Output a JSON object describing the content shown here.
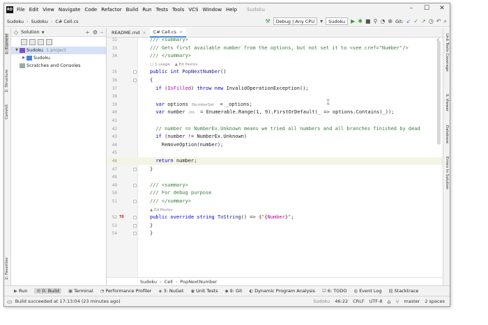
{
  "menu": [
    "File",
    "Edit",
    "View",
    "Navigate",
    "Code",
    "Refactor",
    "Build",
    "Run",
    "Tests",
    "Tools",
    "VCS",
    "Window",
    "Help"
  ],
  "project_title": "Sudoku",
  "toolbar": {
    "crumbs": [
      "Sudoku",
      "Sudoku",
      "C# Cell.cs"
    ],
    "config": "Debug | Any CPU",
    "run_target": "Sudoku",
    "git_label": "Git:"
  },
  "solution": {
    "header": "Solution",
    "tree": [
      {
        "label": "Sudoku",
        "sub": "1 project",
        "level": 0,
        "selected": true,
        "expanded": true
      },
      {
        "label": "Sudoku",
        "sub": "",
        "level": 1,
        "selected": false,
        "expanded": false
      },
      {
        "label": "Scratches and Consoles",
        "sub": "",
        "level": 0,
        "selected": false,
        "expanded": false
      }
    ]
  },
  "left_tabs": [
    "1: Explorer",
    "2: Structure",
    "Commit"
  ],
  "left_tabs_bottom": [
    "2: Favorites"
  ],
  "right_tabs": [
    "Unit Tests Coverage",
    "IL Viewer",
    "Database",
    "Errors In Solution"
  ],
  "editor": {
    "tabs": [
      {
        "label": "README.md",
        "active": false
      },
      {
        "label": "C# Cell.cs",
        "active": true
      }
    ],
    "breadcrumb": [
      "Sudoku",
      "Cell",
      "PopNextNumber"
    ],
    "lines": [
      {
        "n": "32",
        "html": "<span class='c'>/// &lt;summary&gt;</span>"
      },
      {
        "n": "33",
        "html": "<span class='c'>/// Gets first available number from the options, but not set it to &lt;see cref=\"Number\"/&gt;</span>"
      },
      {
        "n": "34",
        "html": "<span class='c'>/// &lt;/summary&gt;</span>"
      },
      {
        "n": "",
        "html": "<span class='hint'>▢ 1 usage    ▲ Ed Pavlov</span>",
        "hint": true
      },
      {
        "n": "35",
        "html": "<span class='k'>public int</span> <span class='m'>PopNextNumber</span>()"
      },
      {
        "n": "36",
        "html": "{"
      },
      {
        "n": "37",
        "html": "  <span class='k'>if</span> (<span class='t'>IsFilled</span>) <span class='k'>throw new</span> InvalidOperationException();"
      },
      {
        "n": "38",
        "html": ""
      },
      {
        "n": "39",
        "html": "  <span class='k'>var</span> options <span class='hint'>:NumberSet</span>  = _options;"
      },
      {
        "n": "40",
        "html": "  <span class='k'>var</span> number <span class='hint'>:int</span>  = Enumerable.Range(1, 9).FirstOrDefault(_ =&gt; options.Contains(_));"
      },
      {
        "n": "41",
        "html": ""
      },
      {
        "n": "42",
        "html": "  <span class='c'>// number == NumberEx.Unknown means we tried all numbers and all branches finished by dead</span>"
      },
      {
        "n": "43",
        "html": "  <span class='k'>if</span> (number != NumberEx.Unknown)"
      },
      {
        "n": "44",
        "html": "    RemoveOption(number);"
      },
      {
        "n": "45",
        "html": ""
      },
      {
        "n": "46",
        "html": "  <span class='k'>return</span> number;",
        "current": true
      },
      {
        "n": "47",
        "html": "}"
      },
      {
        "n": "48",
        "html": ""
      },
      {
        "n": "49",
        "html": "<span class='c'>/// &lt;summary&gt;</span>"
      },
      {
        "n": "50",
        "html": "<span class='c'>/// For debug purpose</span>"
      },
      {
        "n": "51",
        "html": "<span class='c'>/// &lt;/summary&gt;</span>"
      },
      {
        "n": "",
        "html": "<span class='hint'>▲ Ed Pavlov</span>",
        "hint": true
      },
      {
        "n": "52",
        "html": "<span class='k'>public override string</span> <span class='m'>ToString</span>() =&gt; <span class='s'>$\"</span>{<span class='t'>Number</span>}<span class='s'>\"</span>;",
        "marker": "TO"
      },
      {
        "n": "53",
        "html": "}"
      },
      {
        "n": "54",
        "html": "}"
      }
    ]
  },
  "toolwindows": [
    {
      "icon": "▶",
      "label": "Run"
    },
    {
      "icon": "⚙",
      "label": "0: Build",
      "active": true
    },
    {
      "icon": "▣",
      "label": "Terminal"
    },
    {
      "icon": "◔",
      "label": "Performance Profiler"
    },
    {
      "icon": "◈",
      "label": "3: NuGet"
    },
    {
      "icon": "◉",
      "label": "Unit Tests"
    },
    {
      "icon": "◆",
      "label": "9: Git"
    },
    {
      "icon": "◐",
      "label": "Dynamic Program Analysis"
    },
    {
      "icon": "☑",
      "label": "6: TODO"
    },
    {
      "icon": "◍",
      "label": "Event Log"
    },
    {
      "icon": "▤",
      "label": "Stacktrace"
    }
  ],
  "status": {
    "message": "Build succeeded at 17:13:04 (23 minutes ago)",
    "project": "Sudoku",
    "position": "46:22",
    "line_sep": "CRLF",
    "encoding": "UTF-8",
    "branch": "master",
    "indent": "2 spaces"
  }
}
